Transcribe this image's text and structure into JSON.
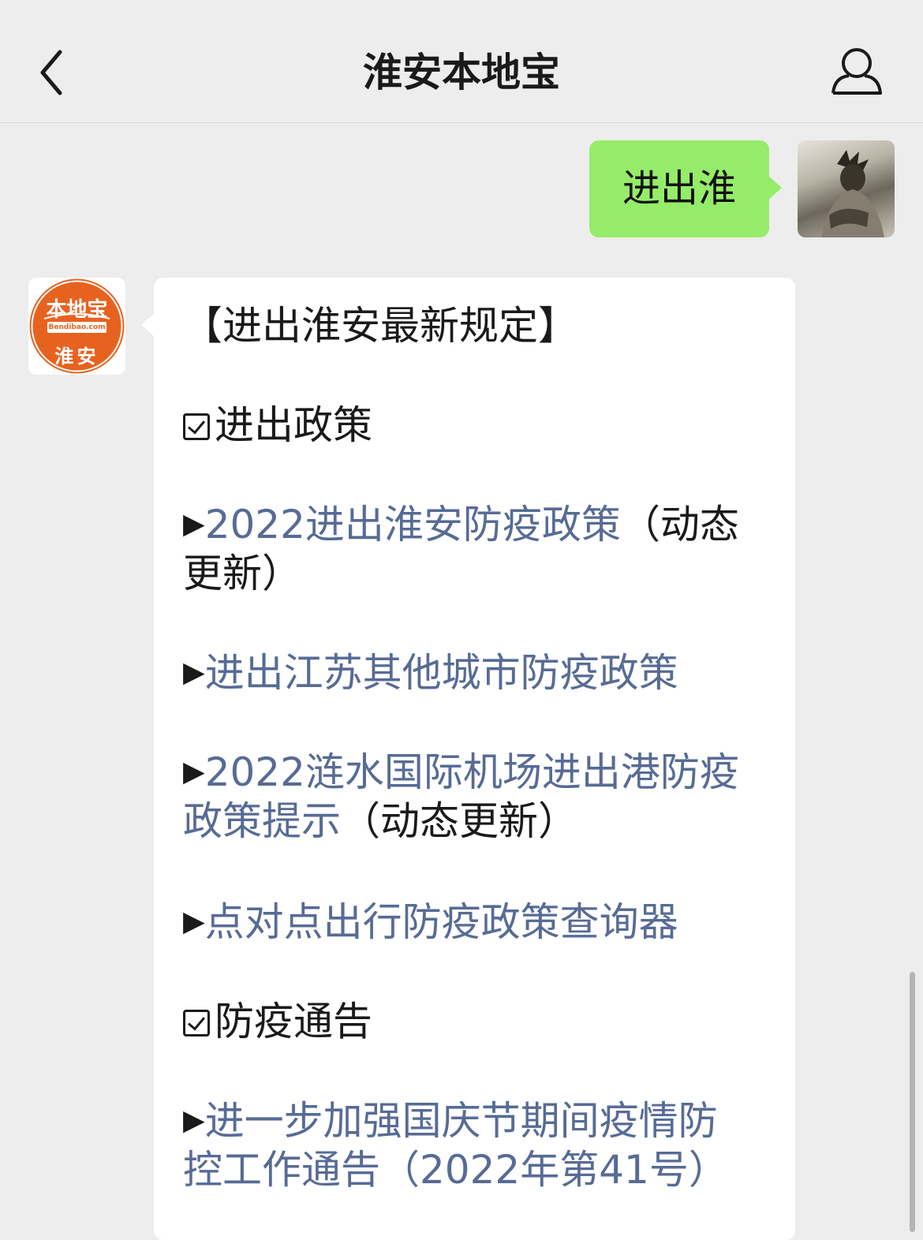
{
  "header": {
    "title": "淮安本地宝",
    "back_icon": "chevron-left-icon",
    "profile_icon": "person-icon"
  },
  "outgoing": {
    "text": "进出淮",
    "bubble_color": "#95ec69"
  },
  "bot": {
    "logo_top": "本地宝",
    "logo_mid": "Bendibao.com",
    "logo_bottom": "淮安",
    "logo_color": "#e8621f"
  },
  "message": {
    "heading": "【进出淮安最新规定】",
    "section1": "进出政策",
    "item1_link_a": "2022进出淮安防疫政策",
    "item1_plain_a": "（动态",
    "item1_plain_b": "更新）",
    "item2_link": "进出江苏其他城市防疫政策",
    "item3_link_a": "2022涟水国际机场进出港防疫",
    "item3_link_b": "政策提示",
    "item3_plain_b": "（动态更新）",
    "item4_link": "点对点出行防疫政策查询器",
    "section2": "防疫通告",
    "item5_link_a": "进一步加强国庆节期间疫情防",
    "item5_link_b": "控工作通告（2022年第41号）",
    "arrow_glyph": "▶",
    "link_color": "#576b95"
  }
}
